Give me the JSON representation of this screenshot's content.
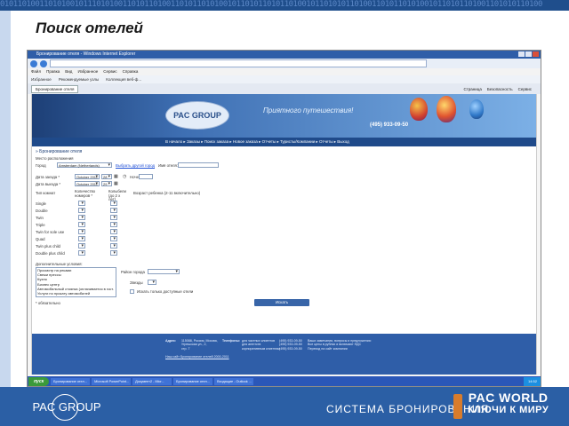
{
  "slide": {
    "title": "Поиск отелей",
    "bottom_logo": "PAC GROUP",
    "bottom_system": "СИСТЕМА БРОНИРОВАНИЯ",
    "bottom_brand_line1": "PAC WORLD",
    "bottom_brand_line2": "КЛЮЧИ К МИРУ",
    "top_digits": "0101101001101010010111010100110101101001101011010100101101011010110100101101010110100110101101010010110101101001101010110100"
  },
  "browser": {
    "window_title": "Бронирование отеля - Windows Internet Explorer",
    "menu": [
      "Файл",
      "Правка",
      "Вид",
      "Избранное",
      "Сервис",
      "Справка"
    ],
    "favorites": [
      "Избранное",
      "Рекомендуемые узлы",
      "Коллекция веб-ф..."
    ],
    "tab": "Бронирование отеля",
    "toolbar_right": [
      "Страница",
      "Безопасность",
      "Сервис"
    ]
  },
  "site": {
    "logo": "PAC GROUP",
    "tagline": "Приятного путешествия!",
    "phone": "(495) 933-09-50",
    "nav": [
      "В начало",
      "Заказы",
      "Поиск заказа",
      "Новое заказа",
      "Отчеты",
      "Туристы/Компании",
      "Отчеты",
      "Выход"
    ]
  },
  "form": {
    "section_title": "» Бронирование отеля",
    "location_label": "Место расположения",
    "city_label": "Город",
    "city_value": "Amsterdam (Netherlands)",
    "other_city_link": "Выбрать другой город",
    "hotel_name_label": "Имя отеля:",
    "checkin_label": "Дата заезда *",
    "checkin_month": "October 2011",
    "checkin_day": "28",
    "nights_label": "Ночей",
    "checkout_label": "Дата выезда *",
    "checkout_month": "October 2011",
    "checkout_day": "29",
    "room_type_label": "Тип комнат",
    "rooms_count_label": "Количество номеров *",
    "cots_label": "Колыбели (до 2 х лет)",
    "child_age_label": "Возраст ребенка (2-11 включительно)",
    "room_types": [
      "Single",
      "Double",
      "Twin",
      "Triple",
      "Twin for sole use",
      "Quad",
      "Twin plus child",
      "Double plus child"
    ],
    "extra_label": "Дополнительные условия:",
    "extras": [
      "Просмотр на реками",
      "Свежи прессы",
      "Кухня",
      "Бизнес центр",
      "Автомобильный стоянка (оплачивается в гост.",
      "Услуги по прокату автомобилей"
    ],
    "district_label": "Район города",
    "stars_label": "Звезды",
    "available_only_label": "Искать только доступные отели",
    "required_note": "* обязательно",
    "search_button": "Искать"
  },
  "footer": {
    "address_label": "Адрес:",
    "address_lines": [
      "115088, Россия, Москва,",
      "Угрешская ул., 2,",
      "стр. 7"
    ],
    "phones_label": "Телефоны:",
    "phone_lines": [
      "для частных клиентов",
      "для агентств",
      "корпоративным клиентам"
    ],
    "phone_values": [
      "(495) 933-09-50",
      "(495) 933-09-50",
      "(495) 933-09-50"
    ],
    "right_lines": [
      "Ваши замечания, вопросы и предложения:",
      "Все цены в рублях и включают НДС",
      "Переход на сайт компании"
    ],
    "copyright": "Наш сайт Бронирование отелей 2000-2011"
  },
  "taskbar": {
    "start": "пуск",
    "items": [
      "Бронирование отел...",
      "Microsoft PowerPoint...",
      "Документ2 - Micr...",
      "Бронирование отел...",
      "Входящие - Outlook ..."
    ],
    "clock": "14:52"
  }
}
